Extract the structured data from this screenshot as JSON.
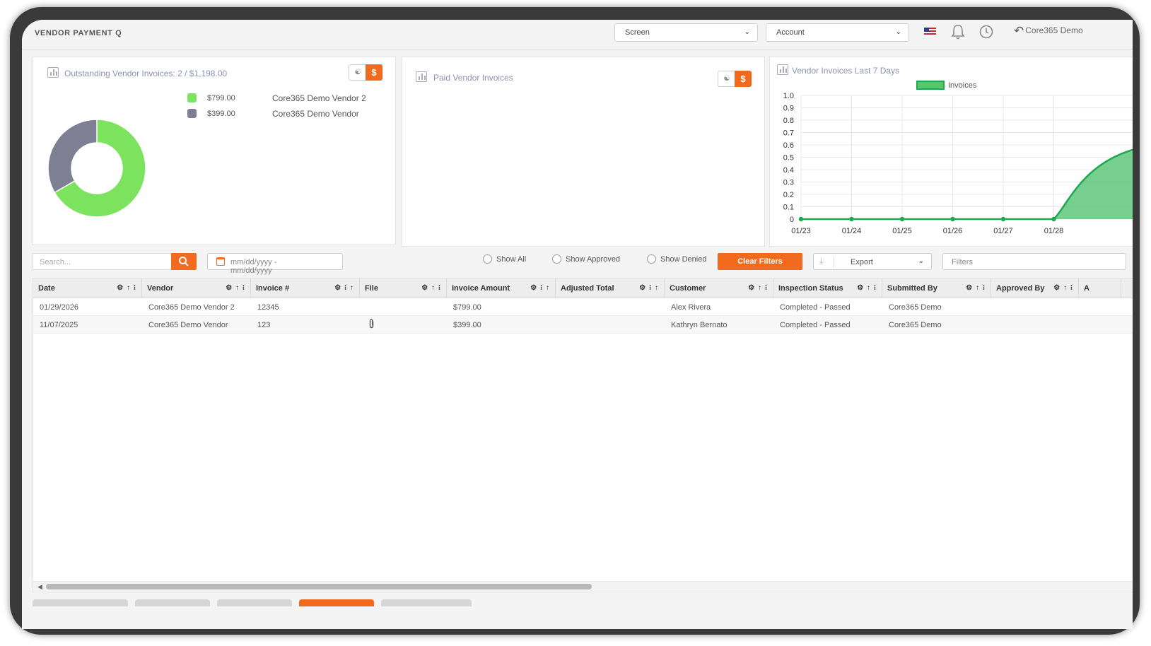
{
  "app": {
    "title": "VENDOR PAYMENT Q"
  },
  "topbar": {
    "screen_select": "Screen",
    "account_select": "Account",
    "user_name": "Core365 Demo"
  },
  "colors": {
    "accent": "#f26a1e",
    "green": "#7be35d",
    "gray": "#7f7f93",
    "line_green": "#1fa84f"
  },
  "cards": {
    "outstanding": {
      "title": "Outstanding Vendor Invoices: 2 / $1,198.00",
      "toggle_count_icon": "people-icon",
      "toggle_amount_label": "$",
      "legend": [
        {
          "amount": "$799.00",
          "vendor": "Core365 Demo Vendor 2",
          "color": "#7be35d"
        },
        {
          "amount": "$399.00",
          "vendor": "Core365 Demo Vendor",
          "color": "#7f7f93"
        }
      ]
    },
    "paid": {
      "title": "Paid Vendor Invoices",
      "toggle_amount_label": "$"
    },
    "last7": {
      "title": "Vendor Invoices Last 7 Days"
    }
  },
  "chart_data": [
    {
      "type": "pie",
      "title": "Outstanding Vendor Invoices: 2 / $1,198.00",
      "categories": [
        "Core365 Demo Vendor 2",
        "Core365 Demo Vendor"
      ],
      "values": [
        799.0,
        399.0
      ]
    },
    {
      "type": "area",
      "title": "Vendor Invoices Last 7 Days",
      "categories": [
        "01/23",
        "01/24",
        "01/25",
        "01/26",
        "01/27",
        "01/28"
      ],
      "series": [
        {
          "name": "Invoices",
          "values": [
            0,
            0,
            0,
            0,
            0,
            0
          ]
        }
      ],
      "ylim": [
        0,
        1.0
      ],
      "yticks": [
        "0",
        "0.1",
        "0.2",
        "0.3",
        "0.4",
        "0.5",
        "0.6",
        "0.7",
        "0.8",
        "0.9",
        "1.0"
      ],
      "legend": "top",
      "grid": true
    }
  ],
  "filters": {
    "search_placeholder": "Search...",
    "date_placeholder": "mm/dd/yyyy - mm/dd/yyyy",
    "show_all": "Show All",
    "show_approved": "Show Approved",
    "show_denied": "Show Denied",
    "clear_filters": "Clear Filters",
    "export": "Export",
    "filters_placeholder": "Filters"
  },
  "table": {
    "columns": [
      {
        "label": "Date",
        "controls": "⚙ ↑ ⁝"
      },
      {
        "label": "Vendor",
        "controls": "⚙ ↑ ⁝"
      },
      {
        "label": "Invoice #",
        "controls": "⚙ ⁝ ↑"
      },
      {
        "label": "File",
        "controls": "⚙ ↑ ⁝"
      },
      {
        "label": "Invoice Amount",
        "controls": "⚙ ⁝ ↑"
      },
      {
        "label": "Adjusted Total",
        "controls": "⚙ ⁝ ↑"
      },
      {
        "label": "Customer",
        "controls": "⚙ ↑ ⁝"
      },
      {
        "label": "Inspection Status",
        "controls": "⚙ ↑ ⁝"
      },
      {
        "label": "Submitted By",
        "controls": "⚙ ↑ ⁝"
      },
      {
        "label": "Approved By",
        "controls": "⚙ ↑ ⁝"
      },
      {
        "label": "A",
        "controls": ""
      }
    ],
    "rows": [
      {
        "date": "01/29/2026",
        "vendor": "Core365 Demo Vendor 2",
        "invoice": "12345",
        "file": "",
        "amount": "$799.00",
        "adjusted": "",
        "customer": "Alex Rivera",
        "status": "Completed - Passed",
        "submitted": "Core365 Demo",
        "approved": ""
      },
      {
        "date": "11/07/2025",
        "vendor": "Core365 Demo Vendor",
        "invoice": "123",
        "file": "paperclip-icon",
        "amount": "$399.00",
        "adjusted": "",
        "customer": "Kathryn Bernato",
        "status": "Completed - Passed",
        "submitted": "Core365 Demo",
        "approved": ""
      }
    ]
  }
}
